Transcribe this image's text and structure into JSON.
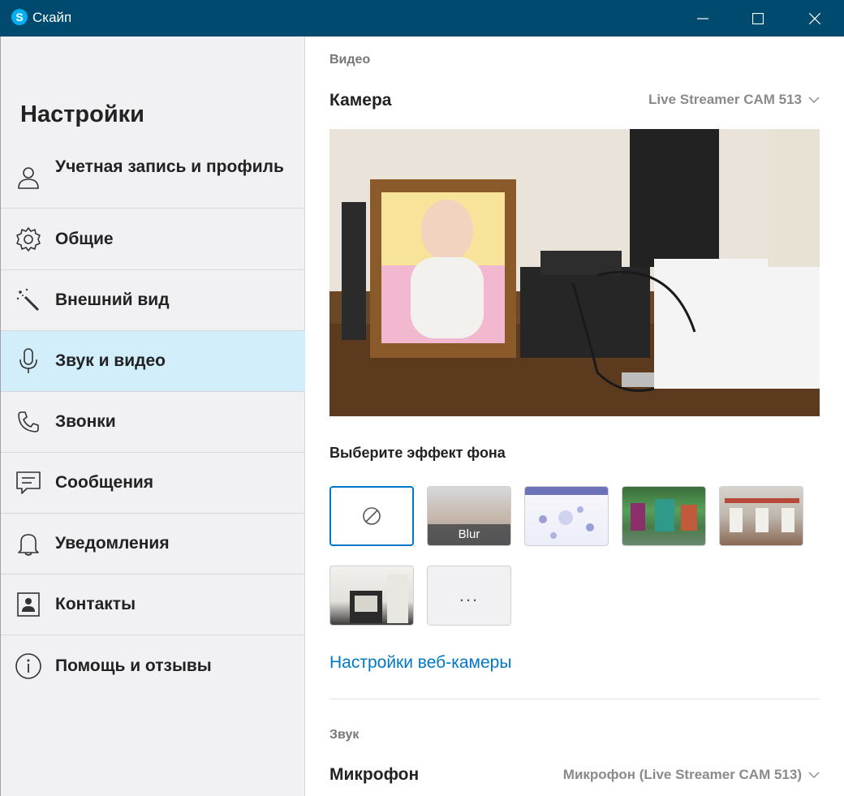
{
  "window": {
    "title": "Скайп",
    "logo_letter": "S"
  },
  "sidebar": {
    "title": "Настройки",
    "items": [
      {
        "label": "Учетная запись и профиль",
        "icon": "person-icon"
      },
      {
        "label": "Общие",
        "icon": "gear-icon"
      },
      {
        "label": "Внешний вид",
        "icon": "magic-wand-icon"
      },
      {
        "label": "Звук и видео",
        "icon": "microphone-icon",
        "active": true
      },
      {
        "label": "Звонки",
        "icon": "phone-icon"
      },
      {
        "label": "Сообщения",
        "icon": "message-icon"
      },
      {
        "label": "Уведомления",
        "icon": "bell-icon"
      },
      {
        "label": "Контакты",
        "icon": "contact-card-icon"
      },
      {
        "label": "Помощь и отзывы",
        "icon": "info-icon"
      }
    ]
  },
  "video": {
    "section_label": "Видео",
    "camera_label": "Камера",
    "camera_value": "Live Streamer CAM 513",
    "background_effect_label": "Выберите эффект фона",
    "effects": [
      {
        "name": "none",
        "selected": true
      },
      {
        "name": "blur",
        "caption": "Blur"
      },
      {
        "name": "image-1"
      },
      {
        "name": "image-2"
      },
      {
        "name": "image-3"
      },
      {
        "name": "image-4"
      },
      {
        "name": "more",
        "label": "..."
      }
    ],
    "webcam_settings_link": "Настройки веб-камеры"
  },
  "audio": {
    "section_label": "Звук",
    "microphone_label": "Микрофон",
    "microphone_value": "Микрофон (Live Streamer CAM 513)"
  },
  "colors": {
    "titlebar": "#004a70",
    "accent": "#0078c8",
    "active_item": "#d1eefa",
    "sidebar_bg": "#f1f1f4"
  }
}
